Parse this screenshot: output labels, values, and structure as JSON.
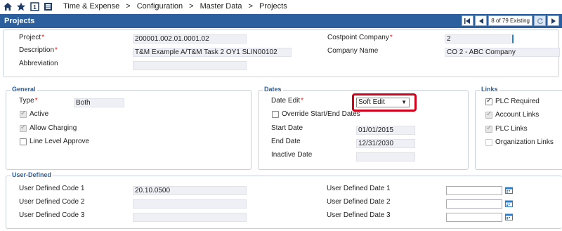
{
  "breadcrumb": {
    "items": [
      "Time & Expense",
      "Configuration",
      "Master Data",
      "Projects"
    ],
    "separator": ">"
  },
  "titlebar": {
    "title": "Projects",
    "record_count": "8 of 79 Existing"
  },
  "header": {
    "project_label": "Project",
    "project_value": "200001.002.01.0001.02",
    "description_label": "Description",
    "description_value": "T&M Example A/T&M Task 2 OY1 SLIN00102",
    "abbreviation_label": "Abbreviation",
    "abbreviation_value": "",
    "costpoint_company_label": "Costpoint Company",
    "costpoint_company_value": "2",
    "company_name_label": "Company Name",
    "company_name_value": "CO 2 - ABC Company",
    "required_mark": "*"
  },
  "general": {
    "title": "General",
    "type_label": "Type",
    "type_value": "Both",
    "active_label": "Active",
    "allow_charging_label": "Allow Charging",
    "line_level_label": "Line Level Approve"
  },
  "dates": {
    "title": "Dates",
    "date_edit_label": "Date Edit",
    "date_edit_value": "Soft Edit",
    "override_label": "Override Start/End Dates",
    "start_label": "Start Date",
    "start_value": "01/01/2015",
    "end_label": "End Date",
    "end_value": "12/31/2030",
    "inactive_label": "Inactive Date",
    "inactive_value": ""
  },
  "links": {
    "title": "Links",
    "plc_required_label": "PLC Required",
    "account_links_label": "Account Links",
    "plc_links_label": "PLC Links",
    "org_links_label": "Organization Links"
  },
  "user_defined": {
    "title": "User-Defined",
    "code1_label": "User Defined Code 1",
    "code1_value": "20.10.0500",
    "code2_label": "User Defined Code 2",
    "code3_label": "User Defined Code 3",
    "date1_label": "User Defined Date 1",
    "date2_label": "User Defined Date 2",
    "date3_label": "User Defined Date 3"
  },
  "colors": {
    "titlebar": "#2b5f9e",
    "section_title": "#2b5f9e",
    "required": "#d22222",
    "highlight": "#d0021b"
  }
}
